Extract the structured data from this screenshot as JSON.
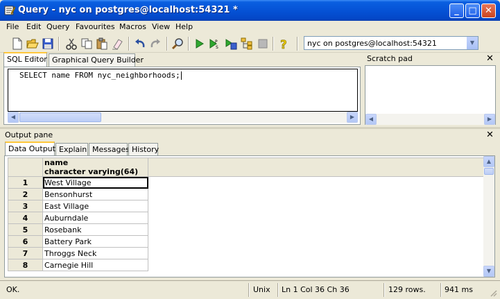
{
  "window": {
    "title": "Query - nyc on postgres@localhost:54321 *",
    "minimize": "_",
    "maximize": "□",
    "close": "✕"
  },
  "menu": [
    "File",
    "Edit",
    "Query",
    "Favourites",
    "Macros",
    "View",
    "Help"
  ],
  "toolbar": {
    "icons": [
      "new-file-icon",
      "open-folder-icon",
      "save-icon",
      "cut-icon",
      "copy-icon",
      "paste-icon",
      "clear-icon",
      "undo-icon",
      "redo-icon",
      "find-icon",
      "execute-icon",
      "execute-pgscript-icon",
      "execute-to-file-icon",
      "explain-icon",
      "cancel-icon",
      "help-icon"
    ],
    "connection": "nyc on postgres@localhost:54321"
  },
  "editor": {
    "tabs": [
      "SQL Editor",
      "Graphical Query Builder"
    ],
    "sql": "SELECT name FROM nyc_neighborhoods;"
  },
  "scratch": {
    "title": "Scratch pad",
    "close": "✕"
  },
  "output": {
    "title": "Output pane",
    "close": "✕",
    "tabs": [
      "Data Output",
      "Explain",
      "Messages",
      "History"
    ],
    "column": {
      "name": "name",
      "type": "character varying(64)"
    },
    "rows": [
      {
        "num": "1",
        "value": "West Village"
      },
      {
        "num": "2",
        "value": "Bensonhurst"
      },
      {
        "num": "3",
        "value": "East Village"
      },
      {
        "num": "4",
        "value": "Auburndale"
      },
      {
        "num": "5",
        "value": "Rosebank"
      },
      {
        "num": "6",
        "value": "Battery Park"
      },
      {
        "num": "7",
        "value": "Throggs Neck"
      },
      {
        "num": "8",
        "value": "Carnegie Hill"
      }
    ]
  },
  "status": {
    "message": "OK.",
    "line_ending": "Unix",
    "position": "Ln 1 Col 36 Ch 36",
    "rows": "129 rows.",
    "time": "941 ms"
  },
  "colors": {
    "titlebar": "#0553d6",
    "chrome": "#ece9d8",
    "active_tab_accent": "#ffc73c"
  }
}
